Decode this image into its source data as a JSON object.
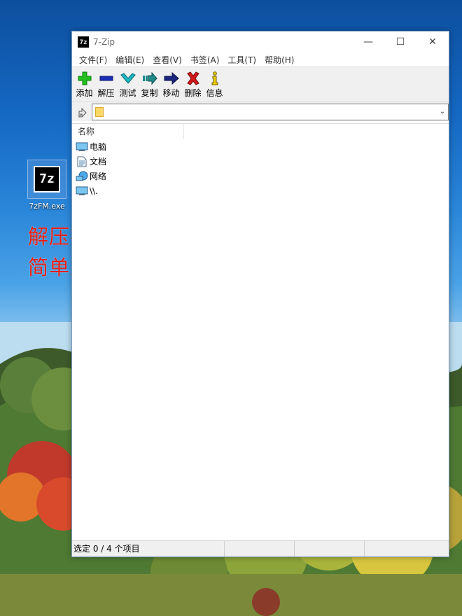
{
  "desktop": {
    "icon_label": "7zFM.exe",
    "icon_logo": "7z",
    "promo_lines": [
      "解压神器",
      "简单直接"
    ],
    "promo_color": "#e61c12"
  },
  "window": {
    "title": "7-Zip",
    "app_icon_text": "7z",
    "controls": {
      "minimize": "—",
      "maximize": "☐",
      "close": "✕"
    },
    "menu": [
      "文件(F)",
      "编辑(E)",
      "查看(V)",
      "书签(A)",
      "工具(T)",
      "帮助(H)"
    ],
    "toolbar": [
      {
        "label": "添加",
        "icon": "plus-icon",
        "color": "#22c01e"
      },
      {
        "label": "解压",
        "icon": "minus-icon",
        "color": "#1b2fb5"
      },
      {
        "label": "测试",
        "icon": "check-icon",
        "color": "#1bb9c4"
      },
      {
        "label": "复制",
        "icon": "copy-arrow-icon",
        "color": "#1e8a8a"
      },
      {
        "label": "移动",
        "icon": "move-arrow-icon",
        "color": "#1b2780"
      },
      {
        "label": "删除",
        "icon": "delete-x-icon",
        "color": "#d11a1a"
      },
      {
        "label": "信息",
        "icon": "info-icon",
        "color": "#f0d000"
      }
    ],
    "address": {
      "value": ""
    },
    "list": {
      "column_name": "名称",
      "items": [
        {
          "name": "电脑",
          "icon": "computer-icon"
        },
        {
          "name": "文档",
          "icon": "document-icon"
        },
        {
          "name": "网络",
          "icon": "network-icon"
        },
        {
          "name": "\\\\.",
          "icon": "monitor-icon"
        }
      ]
    },
    "status": {
      "selection": "选定 0 / 4 个项目"
    }
  }
}
